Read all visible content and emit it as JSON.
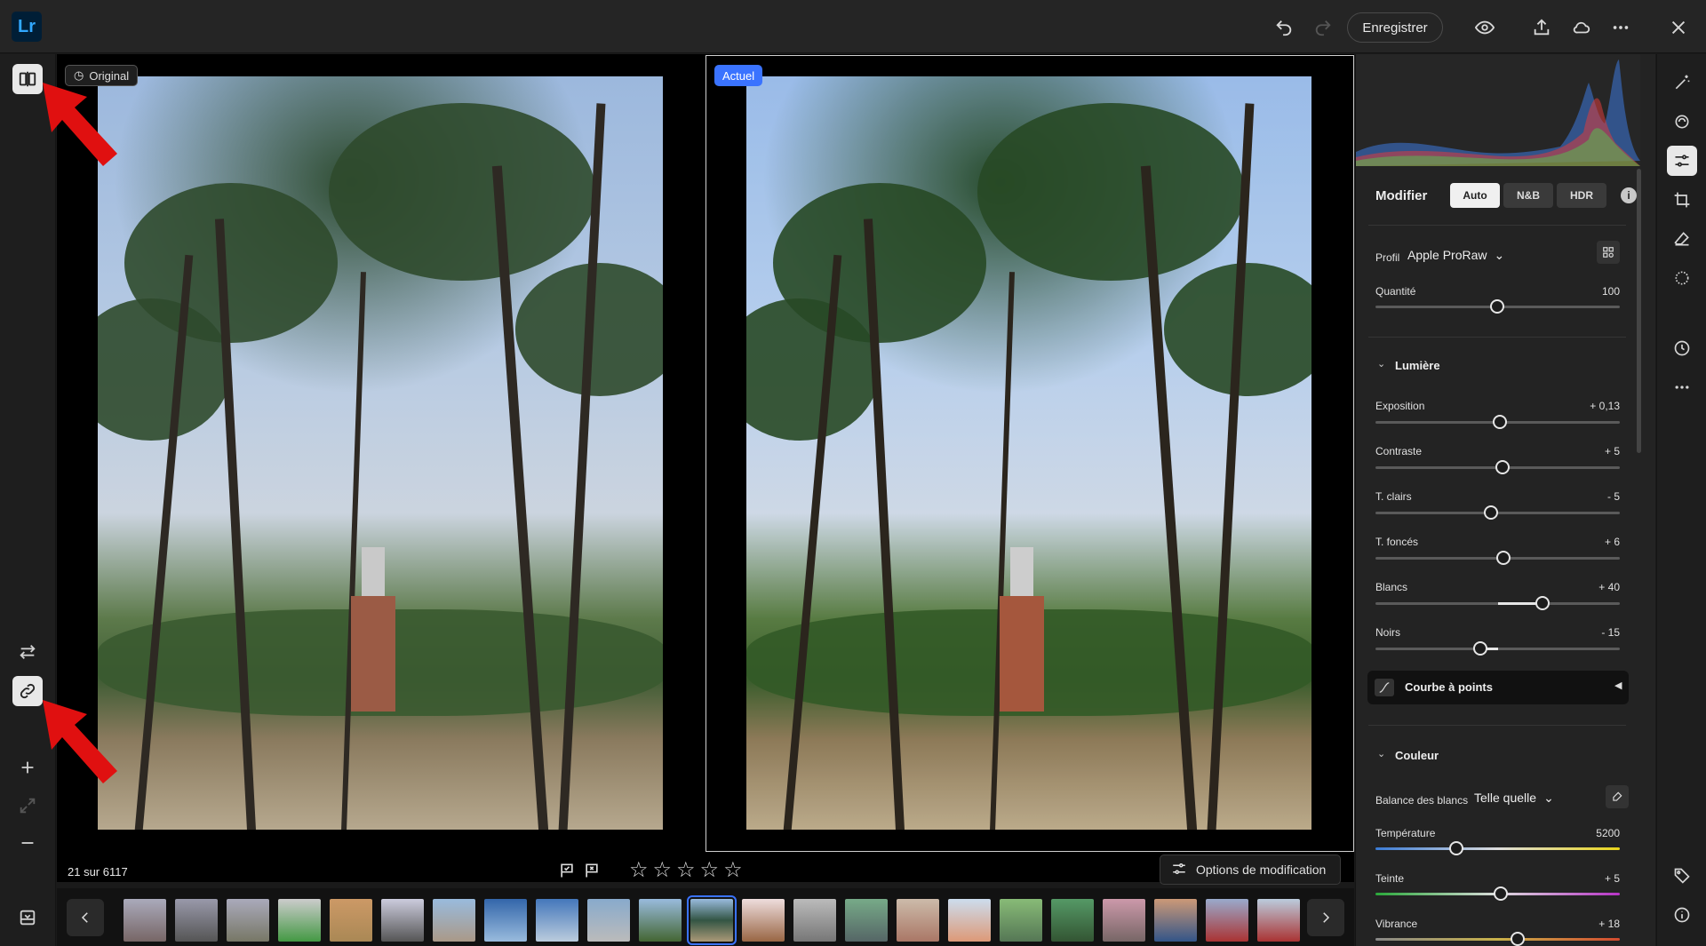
{
  "app": {
    "logo": "Lr"
  },
  "topbar": {
    "save_label": "Enregistrer"
  },
  "view": {
    "original_badge": "Original",
    "current_badge": "Actuel",
    "counter": "21 sur 6117",
    "edit_options_label": "Options de modification"
  },
  "panel": {
    "modifier_title": "Modifier",
    "mode_buttons": [
      "Auto",
      "N&B",
      "HDR"
    ],
    "profile": {
      "label": "Profil",
      "value": "Apple ProRaw"
    },
    "amount": {
      "label": "Quantité",
      "value": "100"
    },
    "lumiere": {
      "title": "Lumière",
      "sliders": [
        {
          "label": "Exposition",
          "value": "+ 0,13"
        },
        {
          "label": "Contraste",
          "value": "+ 5"
        },
        {
          "label": "T. clairs",
          "value": "- 5"
        },
        {
          "label": "T. foncés",
          "value": "+ 6"
        },
        {
          "label": "Blancs",
          "value": "+ 40"
        },
        {
          "label": "Noirs",
          "value": "- 15"
        }
      ]
    },
    "curve": {
      "title": "Courbe à points"
    },
    "couleur": {
      "title": "Couleur",
      "wb": {
        "label": "Balance des blancs",
        "value": "Telle quelle"
      },
      "sliders": [
        {
          "label": "Température",
          "value": "5200"
        },
        {
          "label": "Teinte",
          "value": "+ 5"
        },
        {
          "label": "Vibrance",
          "value": "+ 18"
        }
      ]
    }
  },
  "colors": {
    "accent": "#3a73ff",
    "lr_blue": "#31a8ff",
    "annotation_arrow": "#e01010"
  }
}
